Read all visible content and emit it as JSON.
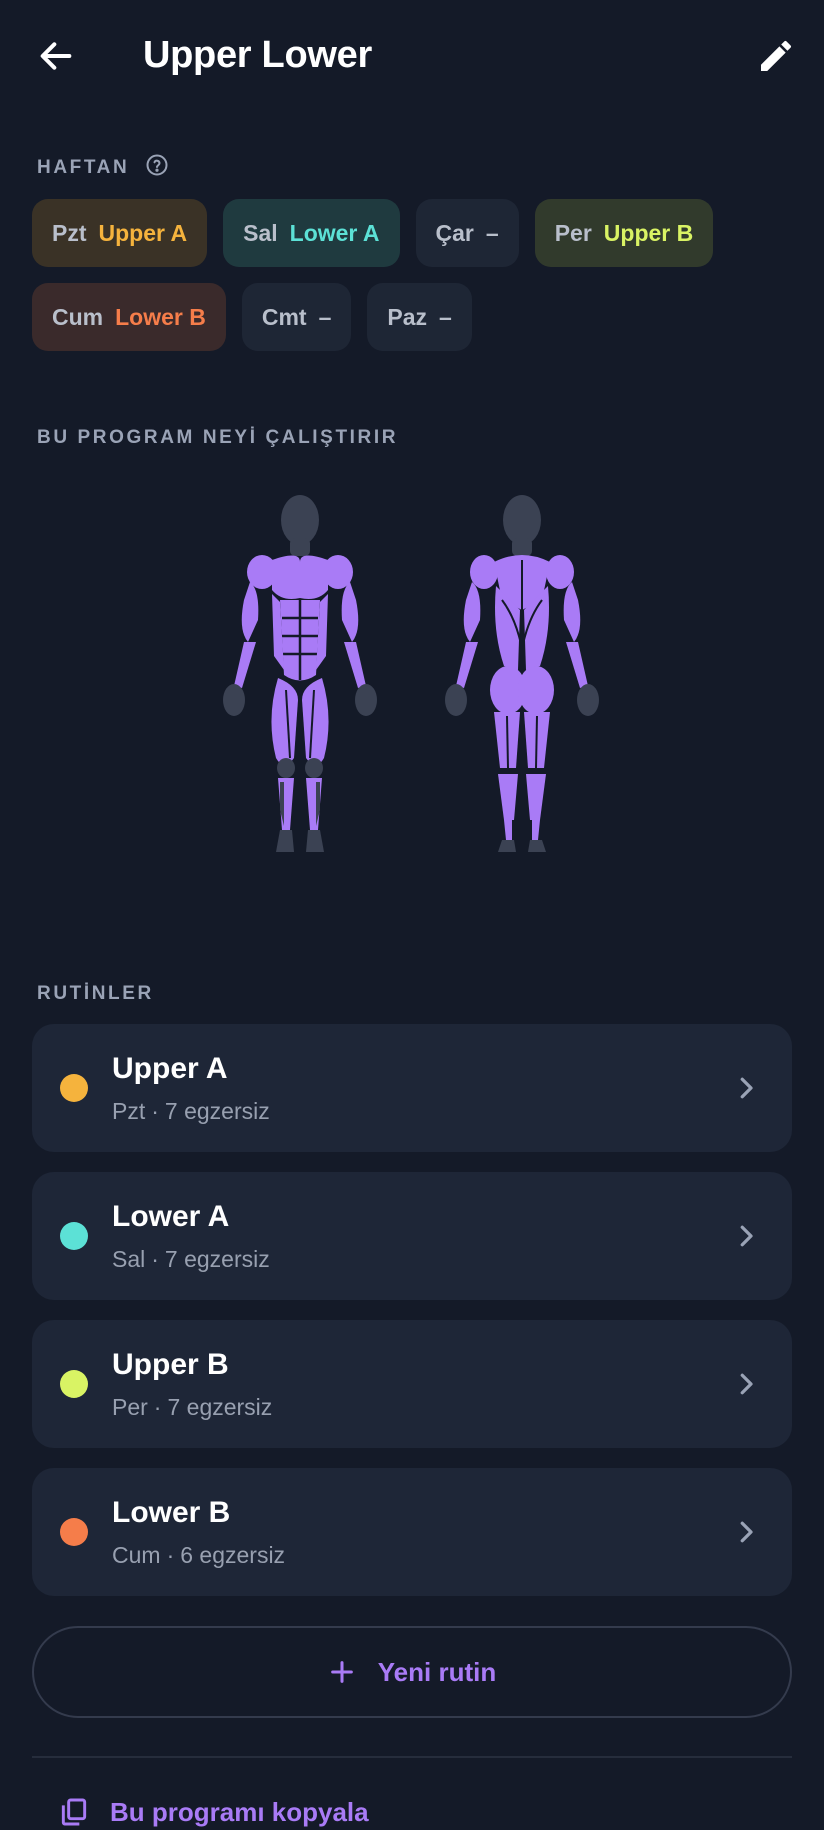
{
  "appbar": {
    "title": "Upper Lower",
    "back_icon": "arrow-left-icon",
    "edit_icon": "pencil-icon"
  },
  "week": {
    "label": "HAFTAN",
    "help_icon": "help-circle-icon",
    "days": [
      {
        "day": "Pzt",
        "routine": "Upper A",
        "color": "#f5b33d",
        "bg": "#3a3226"
      },
      {
        "day": "Sal",
        "routine": "Lower A",
        "color": "#5ce1d6",
        "bg": "#1f3a3f"
      },
      {
        "day": "Çar",
        "routine": "–",
        "color": "#b9bfcb",
        "bg": "#1e2635"
      },
      {
        "day": "Per",
        "routine": "Upper B",
        "color": "#d9f364",
        "bg": "#313a2c"
      },
      {
        "day": "Cum",
        "routine": "Lower B",
        "color": "#f57d4a",
        "bg": "#3a2a2b"
      },
      {
        "day": "Cmt",
        "routine": "–",
        "color": "#b9bfcb",
        "bg": "#1e2635"
      },
      {
        "day": "Paz",
        "routine": "–",
        "color": "#b9bfcb",
        "bg": "#1e2635"
      }
    ]
  },
  "muscles": {
    "label": "BU PROGRAM NEYİ ÇALIŞTIRIR",
    "active_color": "#a97bf6",
    "inactive_color": "#3b4253"
  },
  "routines": {
    "label": "RUTİNLER",
    "items": [
      {
        "name": "Upper A",
        "day": "Pzt",
        "sep": "·",
        "count": "7 egzersiz",
        "color": "#f5b33d"
      },
      {
        "name": "Lower A",
        "day": "Sal",
        "sep": "·",
        "count": "7 egzersiz",
        "color": "#5ce1d6"
      },
      {
        "name": "Upper B",
        "day": "Per",
        "sep": "·",
        "count": "7 egzersiz",
        "color": "#d9f364"
      },
      {
        "name": "Lower B",
        "day": "Cum",
        "sep": "·",
        "count": "6 egzersiz",
        "color": "#f57d4a"
      }
    ]
  },
  "actions": {
    "new_routine": "Yeni rutin",
    "copy_program": "Bu programı kopyala"
  },
  "colors": {
    "background": "#141a28",
    "card": "#1e2637",
    "accent": "#a97bf6"
  }
}
